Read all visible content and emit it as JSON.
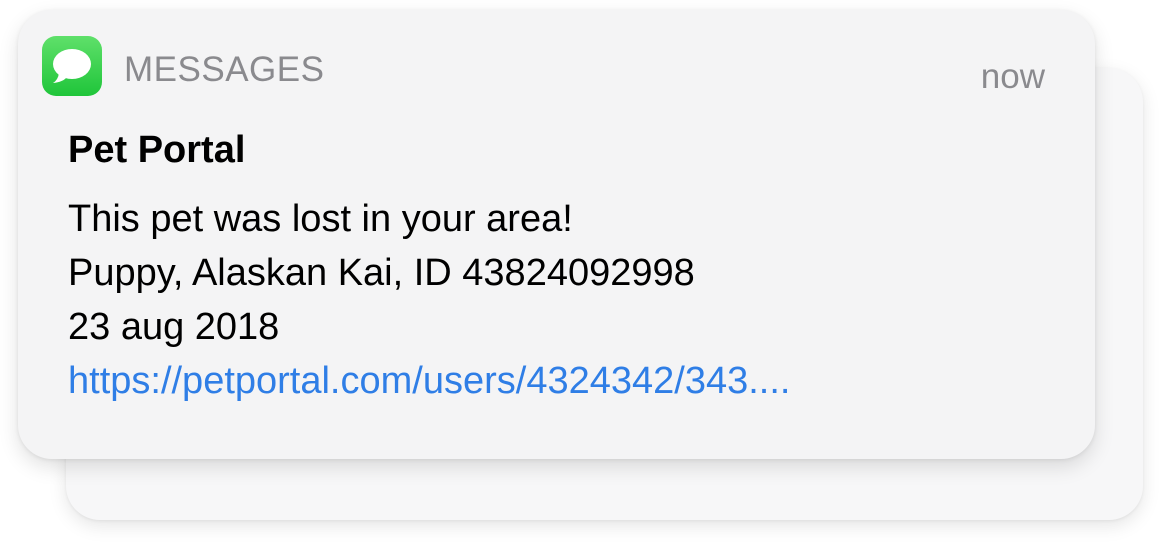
{
  "notification": {
    "app_name": "MESSAGES",
    "time": "now",
    "title": "Pet Portal",
    "lines": [
      "This pet was lost in your area!",
      "Puppy, Alaskan Kai, ID 43824092998",
      "23 aug 2018"
    ],
    "link": "https://petportal.com/users/4324342/343....",
    "app_icon": "messages-bubble-icon"
  },
  "colors": {
    "icon_green": "#28c840",
    "link_blue": "#2f7ee6",
    "secondary_text": "#8a8a8e"
  }
}
